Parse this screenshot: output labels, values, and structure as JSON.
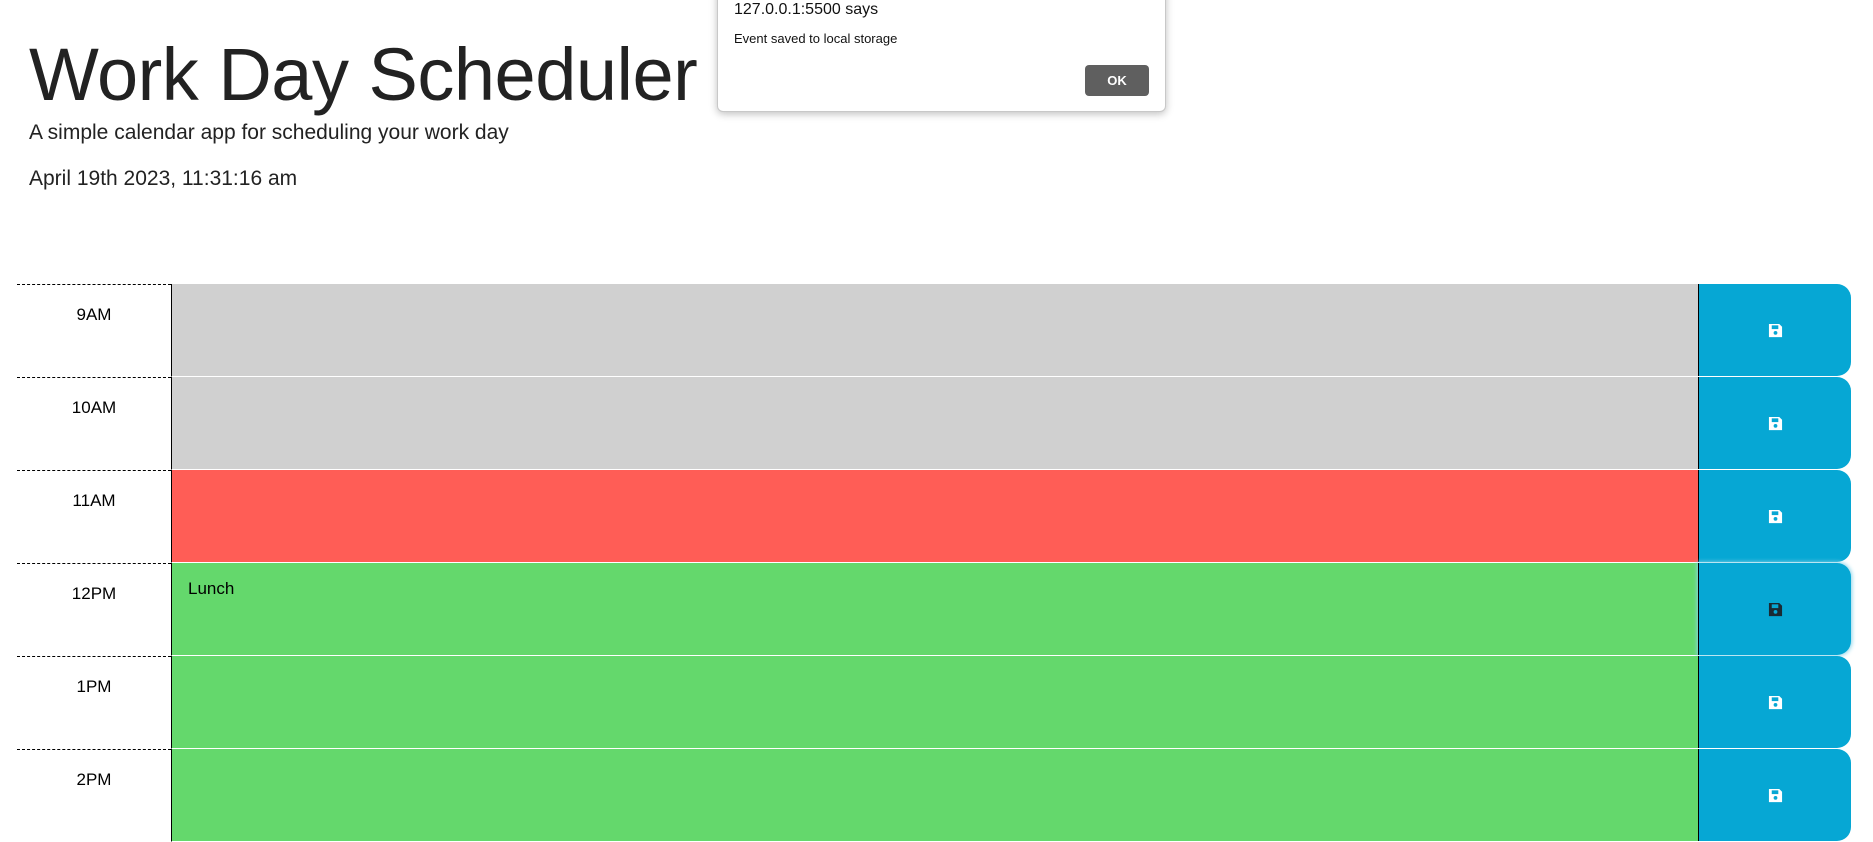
{
  "header": {
    "title": "Work Day Scheduler",
    "subtitle": "A simple calendar app for scheduling your work day",
    "current_day": "April 19th 2023, 11:31:16 am"
  },
  "colors": {
    "past": "#d0d0d0",
    "present": "#ff5d56",
    "future": "#64d86c",
    "save_button": "#06a7d4"
  },
  "schedule": {
    "rows": [
      {
        "hour": "9AM",
        "text": "",
        "state": "past"
      },
      {
        "hour": "10AM",
        "text": "",
        "state": "past"
      },
      {
        "hour": "11AM",
        "text": "",
        "state": "present"
      },
      {
        "hour": "12PM",
        "text": "Lunch",
        "state": "future"
      },
      {
        "hour": "1PM",
        "text": "",
        "state": "future"
      },
      {
        "hour": "2PM",
        "text": "",
        "state": "future"
      }
    ],
    "save_icon": "floppy-disk-icon"
  },
  "dialog": {
    "origin": "127.0.0.1:5500 says",
    "message": "Event saved to local storage",
    "ok_label": "OK"
  }
}
